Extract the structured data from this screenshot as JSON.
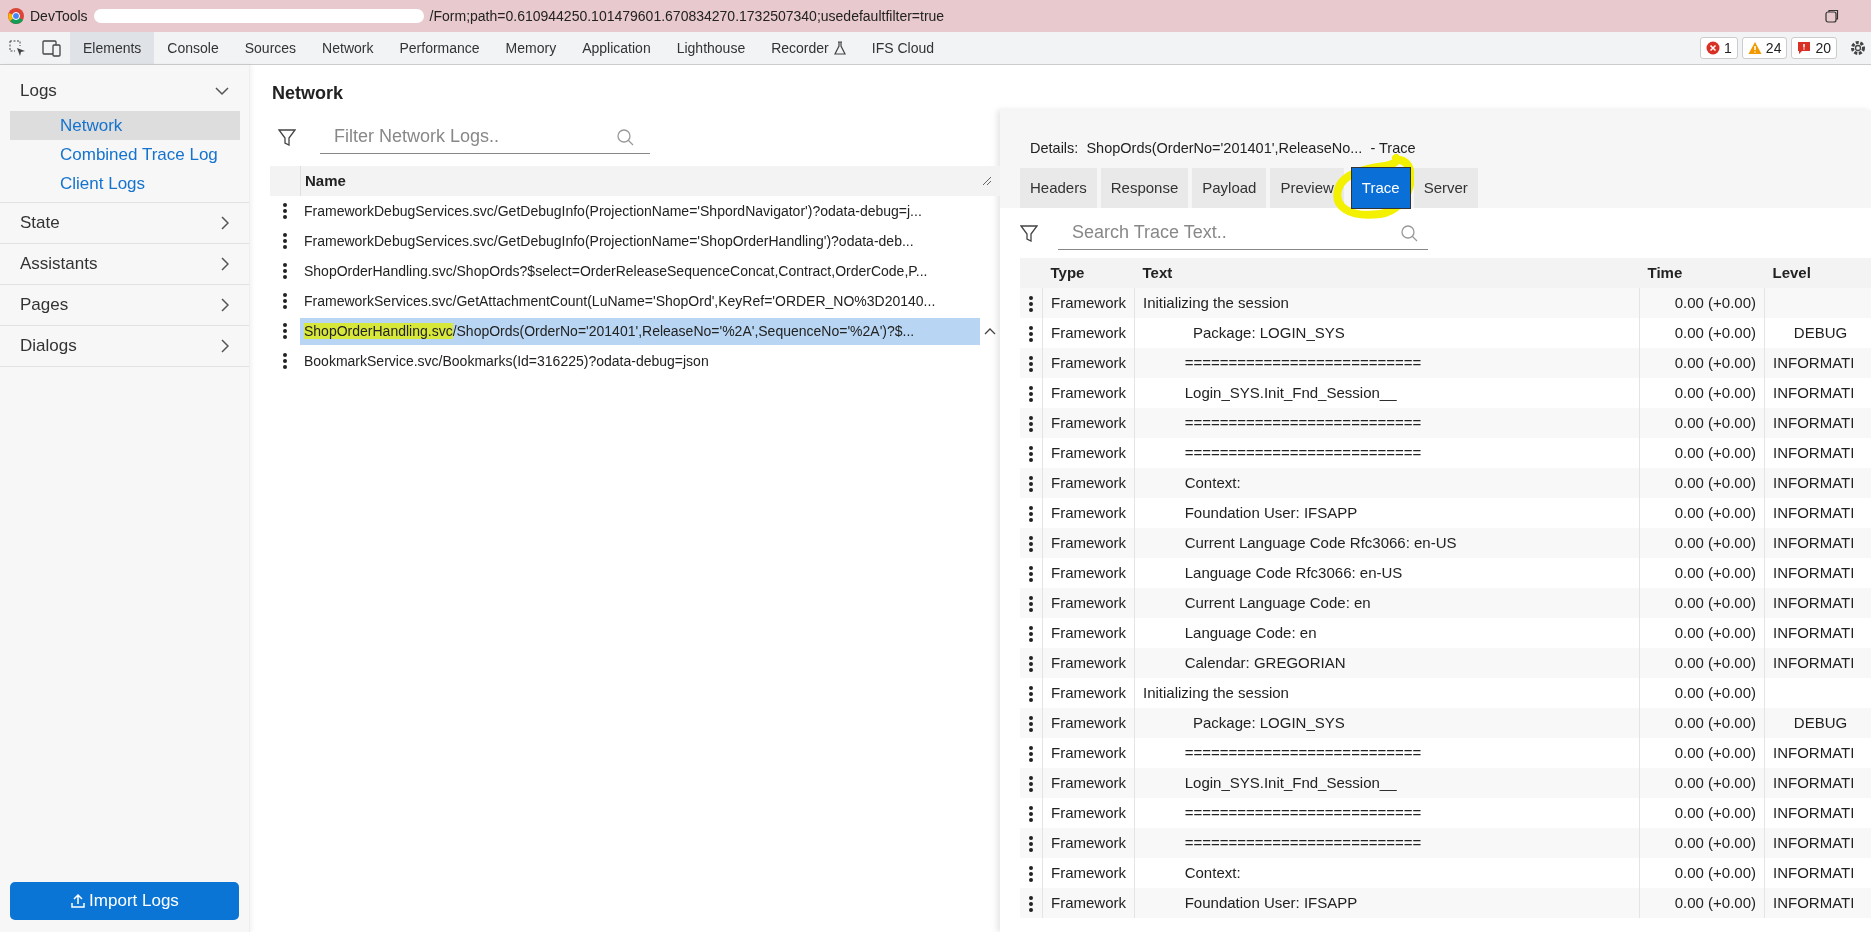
{
  "window": {
    "app": "DevTools",
    "title": "/Form;path=0.610944250.101479601.670834270.1732507340;usedefaultfilter=true"
  },
  "devtools_tabs": [
    {
      "label": "Elements",
      "selected": true,
      "kind": "plain"
    },
    {
      "label": "Console",
      "selected": false,
      "kind": "plain"
    },
    {
      "label": "Sources",
      "selected": false,
      "kind": "plain"
    },
    {
      "label": "Network",
      "selected": false,
      "kind": "plain"
    },
    {
      "label": "Performance",
      "selected": false,
      "kind": "plain"
    },
    {
      "label": "Memory",
      "selected": false,
      "kind": "plain"
    },
    {
      "label": "Application",
      "selected": false,
      "kind": "plain"
    },
    {
      "label": "Lighthouse",
      "selected": false,
      "kind": "plain"
    },
    {
      "label": "Recorder",
      "selected": false,
      "kind": "experimental"
    },
    {
      "label": "IFS Cloud",
      "selected": false,
      "kind": "plain"
    }
  ],
  "issue_counts": [
    {
      "kind": "error",
      "count": "1"
    },
    {
      "kind": "warning",
      "count": "24"
    },
    {
      "kind": "message",
      "count": "20"
    }
  ],
  "sidebar": {
    "sections": [
      {
        "label": "Logs",
        "expanded": true,
        "children": [
          {
            "label": "Network",
            "selected": true
          },
          {
            "label": "Combined Trace Log",
            "selected": false
          },
          {
            "label": "Client Logs",
            "selected": false
          }
        ]
      },
      {
        "label": "State",
        "expanded": false
      },
      {
        "label": "Assistants",
        "expanded": false
      },
      {
        "label": "Pages",
        "expanded": false
      },
      {
        "label": "Dialogs",
        "expanded": false
      }
    ],
    "import_button": "Import Logs"
  },
  "network": {
    "title": "Network",
    "filter_placeholder": "Filter Network Logs..",
    "column": "Name",
    "rows": [
      {
        "text": "FrameworkDebugServices.svc/GetDebugInfo(ProjectionName='ShpordNavigator')?odata-debug=j...",
        "selected": false
      },
      {
        "text": "FrameworkDebugServices.svc/GetDebugInfo(ProjectionName='ShopOrderHandling')?odata-deb...",
        "selected": false
      },
      {
        "text": "ShopOrderHandling.svc/ShopOrds?$select=OrderReleaseSequenceConcat,Contract,OrderCode,P...",
        "selected": false
      },
      {
        "text": "FrameworkServices.svc/GetAttachmentCount(LuName='ShopOrd',KeyRef='ORDER_NO%3D20140...",
        "selected": false
      },
      {
        "highlighted_part": "ShopOrderHandling.svc",
        "text": "/ShopOrds(OrderNo='201401',ReleaseNo='%2A',SequenceNo='%2A')?$...",
        "selected": true
      },
      {
        "text": "BookmarkService.svc/Bookmarks(Id=316225)?odata-debug=json",
        "selected": false
      }
    ]
  },
  "details": {
    "title": "Details:  ShopOrds(OrderNo='201401',ReleaseNo...  - Trace",
    "tabs": [
      {
        "label": "Headers",
        "selected": false,
        "circled": false
      },
      {
        "label": "Response",
        "selected": false,
        "circled": false
      },
      {
        "label": "Payload",
        "selected": false,
        "circled": false
      },
      {
        "label": "Preview",
        "selected": false,
        "circled": false
      },
      {
        "label": "Trace",
        "selected": true,
        "circled": true
      },
      {
        "label": "Server",
        "selected": false,
        "circled": false
      }
    ],
    "search_placeholder": "Search Trace Text..",
    "columns": [
      "Type",
      "Text",
      "Time",
      "Level"
    ],
    "rows": [
      {
        "type": "Framework",
        "text": "Initializing the session",
        "time": "0.00 (+0.00)",
        "level": ""
      },
      {
        "type": "Framework",
        "text": "            Package: LOGIN_SYS",
        "time": "0.00 (+0.00)",
        "level": "     DEBUG"
      },
      {
        "type": "Framework",
        "text": "          ===========================",
        "time": "0.00 (+0.00)",
        "level": "INFORMATI"
      },
      {
        "type": "Framework",
        "text": "          Login_SYS.Init_Fnd_Session__",
        "time": "0.00 (+0.00)",
        "level": "INFORMATI"
      },
      {
        "type": "Framework",
        "text": "          ===========================",
        "time": "0.00 (+0.00)",
        "level": "INFORMATI"
      },
      {
        "type": "Framework",
        "text": "          ===========================",
        "time": "0.00 (+0.00)",
        "level": "INFORMATI"
      },
      {
        "type": "Framework",
        "text": "          Context:",
        "time": "0.00 (+0.00)",
        "level": "INFORMATI"
      },
      {
        "type": "Framework",
        "text": "          Foundation User: IFSAPP",
        "time": "0.00 (+0.00)",
        "level": "INFORMATI"
      },
      {
        "type": "Framework",
        "text": "          Current Language Code Rfc3066: en-US",
        "time": "0.00 (+0.00)",
        "level": "INFORMATI"
      },
      {
        "type": "Framework",
        "text": "          Language Code Rfc3066: en-US",
        "time": "0.00 (+0.00)",
        "level": "INFORMATI"
      },
      {
        "type": "Framework",
        "text": "          Current Language Code: en",
        "time": "0.00 (+0.00)",
        "level": "INFORMATI"
      },
      {
        "type": "Framework",
        "text": "          Language Code: en",
        "time": "0.00 (+0.00)",
        "level": "INFORMATI"
      },
      {
        "type": "Framework",
        "text": "          Calendar: GREGORIAN",
        "time": "0.00 (+0.00)",
        "level": "INFORMATI"
      },
      {
        "type": "Framework",
        "text": "Initializing the session",
        "time": "0.00 (+0.00)",
        "level": ""
      },
      {
        "type": "Framework",
        "text": "            Package: LOGIN_SYS",
        "time": "0.00 (+0.00)",
        "level": "     DEBUG"
      },
      {
        "type": "Framework",
        "text": "          ===========================",
        "time": "0.00 (+0.00)",
        "level": "INFORMATI"
      },
      {
        "type": "Framework",
        "text": "          Login_SYS.Init_Fnd_Session__",
        "time": "0.00 (+0.00)",
        "level": "INFORMATI"
      },
      {
        "type": "Framework",
        "text": "          ===========================",
        "time": "0.00 (+0.00)",
        "level": "INFORMATI"
      },
      {
        "type": "Framework",
        "text": "          ===========================",
        "time": "0.00 (+0.00)",
        "level": "INFORMATI"
      },
      {
        "type": "Framework",
        "text": "          Context:",
        "time": "0.00 (+0.00)",
        "level": "INFORMATI"
      },
      {
        "type": "Framework",
        "text": "          Foundation User: IFSAPP",
        "time": "0.00 (+0.00)",
        "level": "INFORMATI"
      }
    ]
  }
}
